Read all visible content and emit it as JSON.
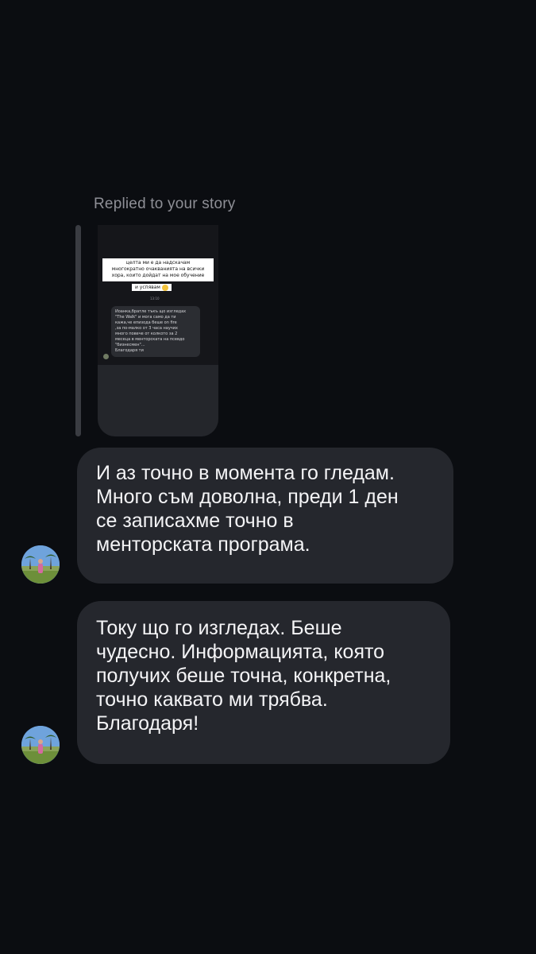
{
  "conversation": {
    "reply_label": "Replied to your story",
    "story_preview": {
      "quote_lines": [
        "целта ми е да надскачам",
        "многократно очакванията на всички",
        "хора, които дойдат на мое обучение"
      ],
      "quote_tail": "и успявам",
      "timestamp": "13:10",
      "inner_message_lines": [
        "Йоанка,братле тъкъ що изгледах",
        "\"The Walk\" и мога само да ти",
        "кажа,че епизода беше on fire",
        ",за по-малко от 3 часа научих",
        "много повече от колкото за 2",
        "месеца в менторската на псевдо",
        "\"бизнесмен\"...",
        "Благодаря ти"
      ]
    },
    "messages": [
      {
        "lines": [
          "И аз точно в момента го гледам.",
          "Много съм доволна, преди 1 ден",
          "се записахме точно в",
          "менторската програма."
        ]
      },
      {
        "lines": [
          "Току що го изгледах. Беше",
          "чудесно. Информацията, която",
          "получих беше точна, конкретна,",
          "точно каквато ми трябва.",
          "Благодаря!"
        ]
      }
    ]
  },
  "colors": {
    "background": "#0b0d11",
    "bubble": "#25272d",
    "muted_text": "#8e8f96",
    "text": "#f4f4f6"
  },
  "icons": {
    "avatar": "avatar-icon"
  }
}
